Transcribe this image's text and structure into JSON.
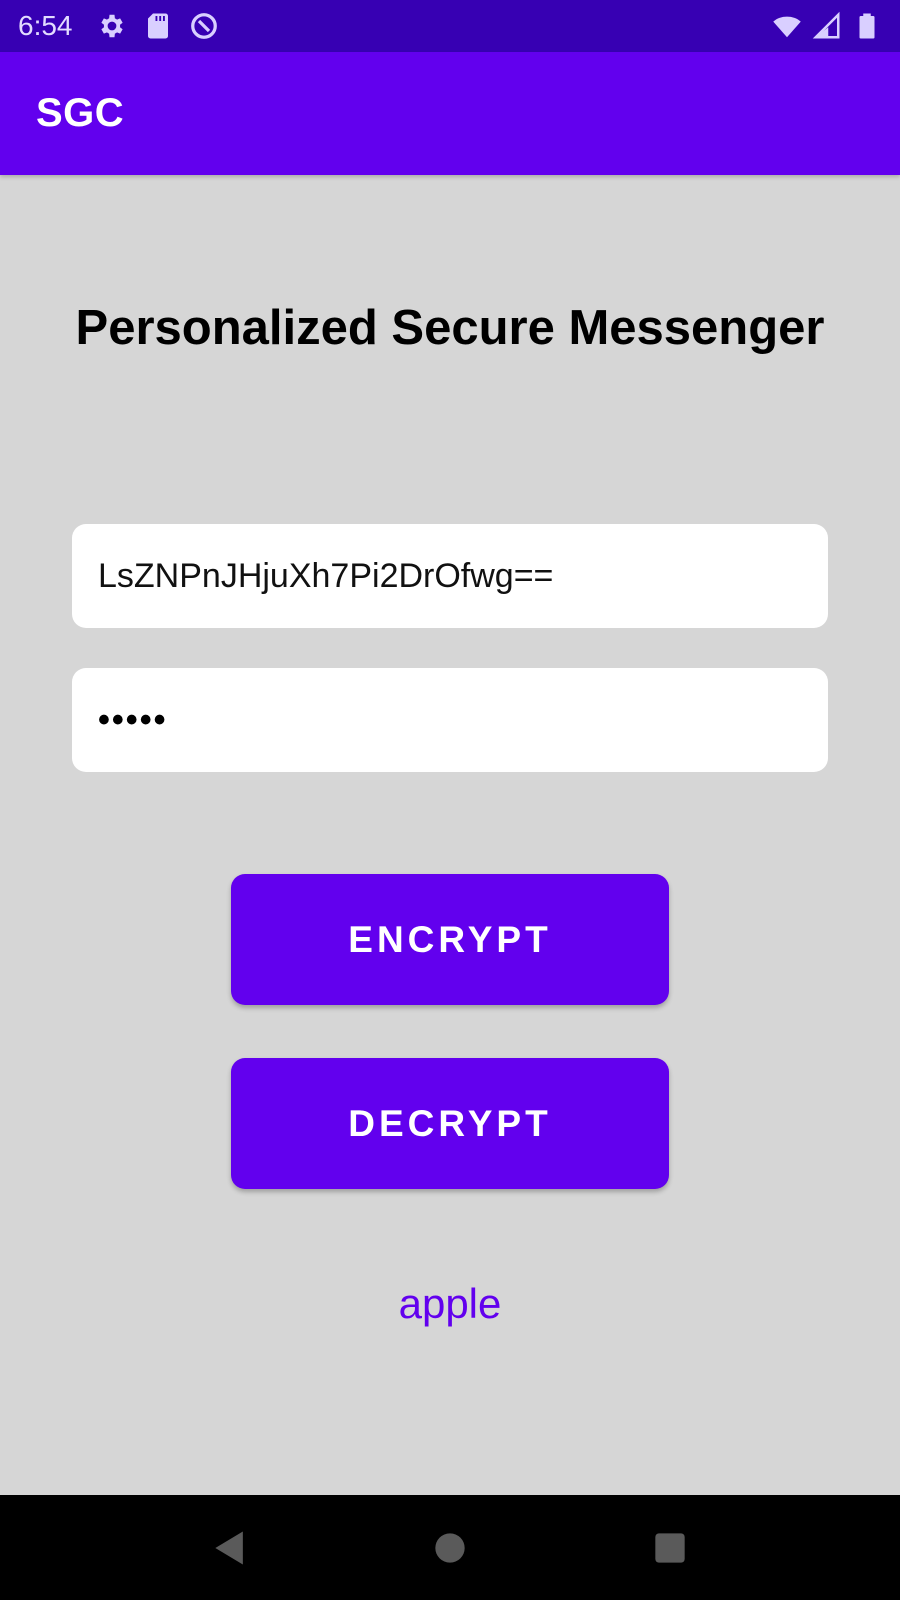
{
  "status_bar": {
    "time": "6:54",
    "left_icons": [
      "settings-icon",
      "sd-card-icon",
      "data-saver-icon"
    ],
    "right_icons": [
      "wifi-icon",
      "cell-signal-icon",
      "battery-icon"
    ]
  },
  "app_bar": {
    "title": "SGC"
  },
  "main": {
    "heading": "Personalized Secure Messenger",
    "message_field": {
      "value": "LsZNPnJHjuXh7Pi2DrOfwg=="
    },
    "password_field": {
      "masked_value": "•••••"
    },
    "encrypt_label": "ENCRYPT",
    "decrypt_label": "DECRYPT",
    "result_text": "apple"
  },
  "nav_bar": {
    "buttons": [
      "back-icon",
      "home-icon",
      "recents-icon"
    ]
  },
  "colors": {
    "status_bar": "#3700b3",
    "primary": "#6200ee",
    "background": "#d6d6d6",
    "field_bg": "#ffffff",
    "nav_bar": "#000000"
  }
}
